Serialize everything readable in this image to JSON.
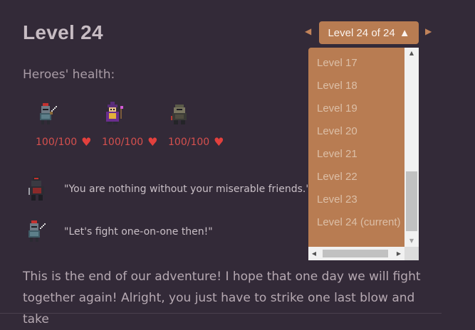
{
  "page": {
    "title": "Level 24"
  },
  "health": {
    "label": "Heroes' health:",
    "heroes": [
      {
        "name": "knight",
        "hp": "100/100"
      },
      {
        "name": "wizard",
        "hp": "100/100"
      },
      {
        "name": "rogue",
        "hp": "100/100"
      }
    ]
  },
  "dialog": [
    {
      "speaker": "villain",
      "text": "\"You are nothing without your miserable friends.\""
    },
    {
      "speaker": "knight",
      "text": "\"Let's fight one-on-one then!\""
    }
  ],
  "story": {
    "text": "This is the end of our adventure! I hope that one day we will fight together again! Alright, you just have to strike one last blow and take"
  },
  "level_nav": {
    "prev_glyph": "◀",
    "next_glyph": "▶",
    "button_label": "Level 24 of 24",
    "button_caret": "▲",
    "options": [
      "Level 17",
      "Level 18",
      "Level 19",
      "Level 20",
      "Level 21",
      "Level 22",
      "Level 23",
      "Level 24 (current)"
    ]
  },
  "scrollbars": {
    "up_glyph": "▲",
    "down_glyph": "▼",
    "left_glyph": "◀",
    "right_glyph": "▶"
  },
  "colors": {
    "background": "#332a38",
    "accent": "#b87c52",
    "health": "#d6504e",
    "heart": "#e2403d"
  }
}
